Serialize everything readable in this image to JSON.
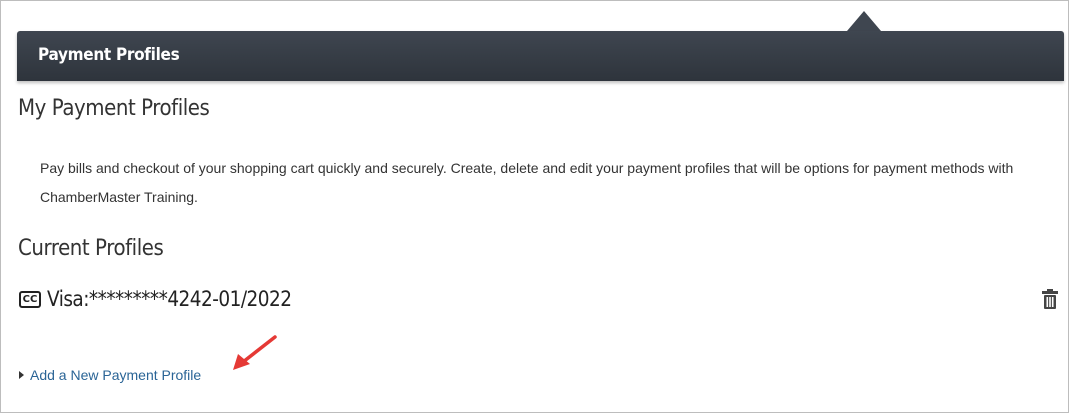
{
  "panel": {
    "header_title": "Payment Profiles"
  },
  "main": {
    "heading": "My Payment Profiles",
    "description": "Pay bills and checkout of your shopping cart quickly and securely. Create, delete and edit your payment profiles that will be options for payment methods with ChamberMaster Training."
  },
  "profiles": {
    "heading": "Current Profiles",
    "items": [
      {
        "icon": "cc-icon",
        "icon_text": "CC",
        "label": "Visa:*********4242-01/2022"
      }
    ],
    "add_link_label": "Add a New Payment Profile"
  },
  "colors": {
    "header_bg": "#3f4650",
    "link": "#2a6496",
    "annotation_arrow": "#e53935"
  },
  "icons": [
    "cc-icon",
    "trash-icon",
    "caret-right-icon",
    "annotation-arrow-icon"
  ]
}
